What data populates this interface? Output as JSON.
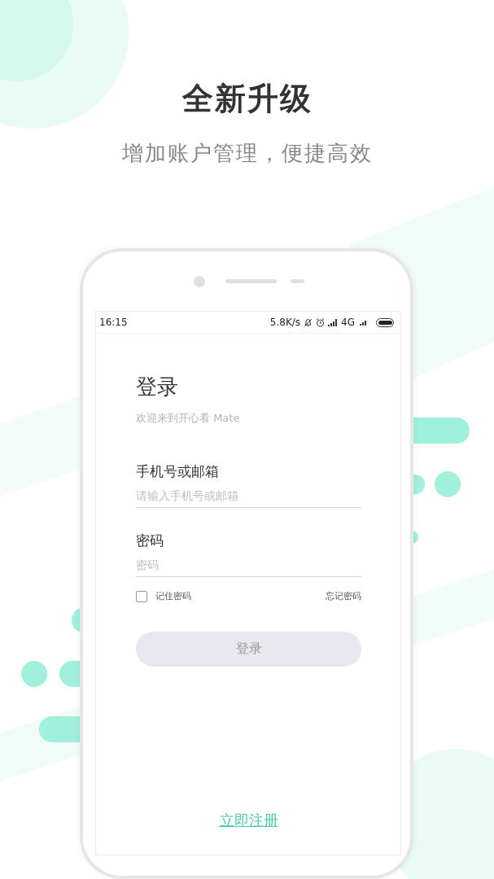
{
  "headline": "全新升级",
  "subheadline": "增加账户管理，便捷高效",
  "status_bar": {
    "time": "16:15",
    "speed": "5.8K/s",
    "network": "4G"
  },
  "login": {
    "title": "登录",
    "welcome": "欢迎来到开心看 Mate",
    "fields": [
      {
        "label": "手机号或邮箱",
        "placeholder": "请输入手机号或邮箱"
      },
      {
        "label": "密码",
        "placeholder": "密码"
      }
    ],
    "remember": {
      "label": "记住密码",
      "checked": false
    },
    "forgot": "忘记密码",
    "submit": {
      "label": "登录",
      "disabled": true
    },
    "register": "立即注册"
  }
}
